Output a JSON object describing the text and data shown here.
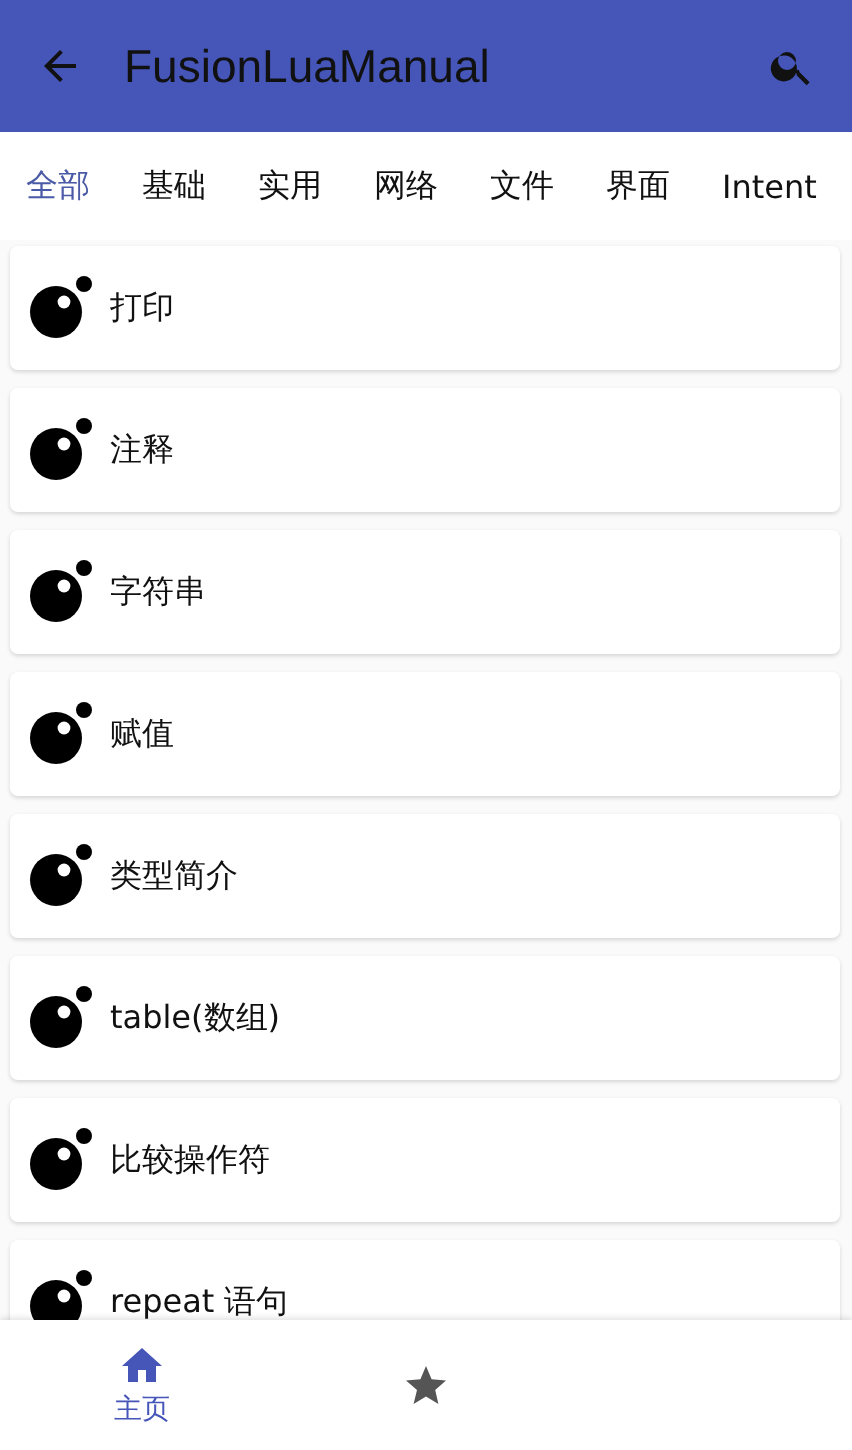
{
  "app_bar": {
    "title": "FusionLuaManual"
  },
  "tabs": [
    {
      "label": "全部",
      "selected": true
    },
    {
      "label": "基础",
      "selected": false
    },
    {
      "label": "实用",
      "selected": false
    },
    {
      "label": "网络",
      "selected": false
    },
    {
      "label": "文件",
      "selected": false
    },
    {
      "label": "界面",
      "selected": false
    },
    {
      "label": "Intent",
      "selected": false
    }
  ],
  "items": [
    {
      "label": "打印"
    },
    {
      "label": "注释"
    },
    {
      "label": "字符串"
    },
    {
      "label": "赋值"
    },
    {
      "label": "类型简介"
    },
    {
      "label": "table(数组)"
    },
    {
      "label": "比较操作符"
    },
    {
      "label": "repeat 语句"
    }
  ],
  "bottom_nav": [
    {
      "kind": "home",
      "label": "主页",
      "selected": true
    },
    {
      "kind": "star",
      "selected": false
    }
  ]
}
